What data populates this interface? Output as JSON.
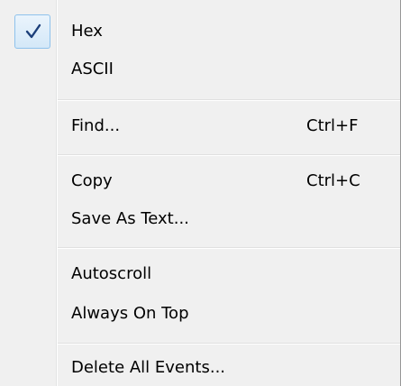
{
  "menu": {
    "items": [
      {
        "label": "Hex",
        "checked": true
      },
      {
        "label": "ASCII"
      },
      {
        "label": "Find...",
        "shortcut": "Ctrl+F"
      },
      {
        "label": "Copy",
        "shortcut": "Ctrl+C"
      },
      {
        "label": "Save As Text..."
      },
      {
        "label": "Autoscroll"
      },
      {
        "label": "Always On Top"
      },
      {
        "label": "Delete All Events..."
      }
    ]
  },
  "colors": {
    "menu_background": "#f0f0f0",
    "check_highlight_border": "#8ec2ec",
    "check_mark": "#1c3f7a",
    "separator": "#e0e0e0"
  },
  "icons": {
    "check": "check-icon"
  }
}
